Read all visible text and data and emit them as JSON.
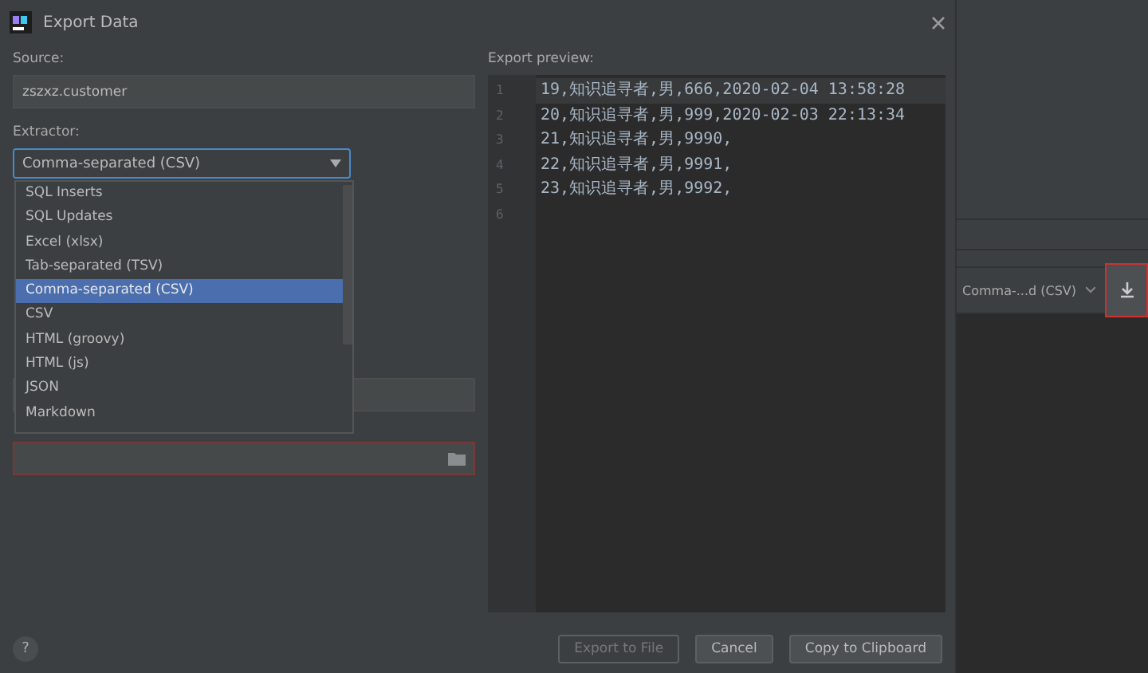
{
  "window": {
    "title": "Export Data"
  },
  "source": {
    "label": "Source:",
    "value": "zszxz.customer"
  },
  "extractor": {
    "label": "Extractor:",
    "value": "Comma-separated (CSV)",
    "expanded": true,
    "options": [
      {
        "label": "SQL Inserts",
        "selected": false
      },
      {
        "label": "SQL Updates",
        "selected": false
      },
      {
        "label": "Excel (xlsx)",
        "selected": false
      },
      {
        "label": "Tab-separated (TSV)",
        "selected": false
      },
      {
        "label": "Comma-separated (CSV)",
        "selected": true
      },
      {
        "label": "CSV",
        "selected": false
      },
      {
        "label": "HTML (groovy)",
        "selected": false
      },
      {
        "label": "HTML (js)",
        "selected": false
      },
      {
        "label": "JSON",
        "selected": false
      },
      {
        "label": "Markdown",
        "selected": false
      }
    ]
  },
  "output_field": {
    "invalid": true
  },
  "preview": {
    "label": "Export preview:",
    "lines": [
      {
        "number": "1",
        "text": "19,知识追寻者,男,666,2020-02-04 13:58:28",
        "current": true
      },
      {
        "number": "2",
        "text": "20,知识追寻者,男,999,2020-02-03 22:13:34",
        "current": false
      },
      {
        "number": "3",
        "text": "21,知识追寻者,男,9990,",
        "current": false
      },
      {
        "number": "4",
        "text": "22,知识追寻者,男,9991,",
        "current": false
      },
      {
        "number": "5",
        "text": "23,知识追寻者,男,9992,",
        "current": false
      },
      {
        "number": "6"
      }
    ]
  },
  "help": {
    "label": "?"
  },
  "buttons": [
    {
      "label": "Export to File",
      "disabled": true
    },
    {
      "label": "Cancel",
      "disabled": false
    },
    {
      "label": "Copy to Clipboard",
      "disabled": false
    }
  ],
  "background_ide": {
    "format": "Comma-...d (CSV)"
  }
}
